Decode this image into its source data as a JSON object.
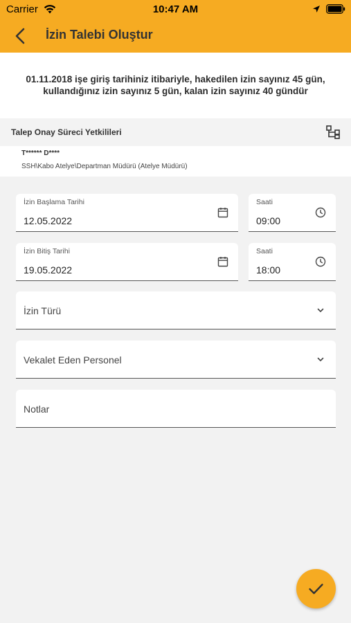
{
  "status_bar": {
    "carrier": "Carrier",
    "time": "10:47 AM"
  },
  "app_bar": {
    "title": "İzin Talebi Oluştur"
  },
  "info": {
    "text": "01.11.2018 işe giriş tarihiniz itibariyle, hakedilen izin sayınız 45 gün, kullandığınız izin sayınız 5 gün, kalan izin sayınız 40 gündür"
  },
  "approval": {
    "title": "Talep Onay Süreci Yetkilileri",
    "approver_name": "T****** D****",
    "approver_role": "SSH\\Kabo Atelye\\Departman Müdürü (Atelye Müdürü)"
  },
  "form": {
    "start_date": {
      "label": "İzin Başlama Tarihi",
      "value": "12.05.2022"
    },
    "start_time": {
      "label": "Saati",
      "value": "09:00"
    },
    "end_date": {
      "label": "İzin Bitiş Tarihi",
      "value": "19.05.2022"
    },
    "end_time": {
      "label": "Saati",
      "value": "18:00"
    },
    "leave_type": {
      "placeholder": "İzin Türü"
    },
    "proxy": {
      "placeholder": "Vekalet Eden Personel"
    },
    "notes": {
      "placeholder": "Notlar"
    }
  },
  "colors": {
    "accent": "#f6ab22",
    "background": "#f2f2f2"
  },
  "icons": [
    "wifi-icon",
    "location-icon",
    "battery-icon",
    "back-arrow-icon",
    "hierarchy-icon",
    "calendar-icon",
    "clock-icon",
    "chevron-down-icon",
    "check-icon"
  ]
}
